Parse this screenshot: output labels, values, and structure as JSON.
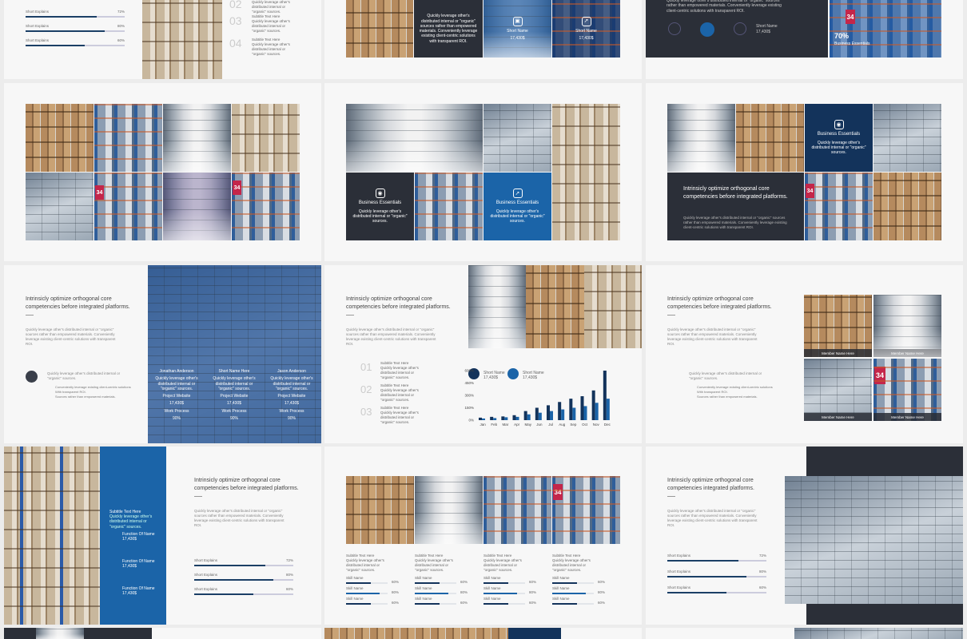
{
  "colors": {
    "navy": "#13335b",
    "blue": "#1b64a8",
    "dark": "#2b2f38",
    "page_bg": "#ececec"
  },
  "common": {
    "headline": "Intrinsicly optimize orthogonal core competencies before integrated platforms.",
    "headline_short": "Intrinsicly optimize orthogonal core competencies integrated platforms.",
    "body": "Quickly leverage other's distributed internal or \"organic\" sources rather than empowered materials. Conveniently leverage existing client-centric solutions with transparent ROI.",
    "body_small": "Quickly leverage other's distributed internal or \"organic\" sources.",
    "card_title": "Business Essentials",
    "card_body": "Quickly leverage other's distributed internal or \"organic\" sources.",
    "subtitle": "Subtitle Text Here",
    "short_name": "Short Name",
    "skill_name": "Skill Name",
    "member_name": "Member Name Here",
    "bullets": [
      "Conveniently leverage existing client-centric solutions",
      "With transparent ROI.",
      "Sources rather than empowered materials."
    ]
  },
  "slide1": {
    "bars": [
      {
        "label": "Short Explains",
        "pct": "72%",
        "value": 72
      },
      {
        "label": "Short Explains",
        "pct": "80%",
        "value": 80
      },
      {
        "label": "Short Explains",
        "pct": "60%",
        "value": 60
      }
    ]
  },
  "slide2": {
    "steps": [
      "02",
      "03",
      "04"
    ],
    "step_title": "Subtitle Text Here"
  },
  "slide3": {
    "stat_label": "Short Name",
    "stat_value": "17,430$"
  },
  "slide4": {
    "stat_label": "Short Name",
    "stat_value": "17,430$",
    "percent": "70%",
    "percent_text": "Business Essentials"
  },
  "slide7": {
    "columns": [
      {
        "title": "Jonathan Anderson",
        "stats": [
          {
            "label": "Project Website",
            "value": "17,430$"
          },
          {
            "label": "Work Process",
            "value": "90%"
          }
        ]
      },
      {
        "title": "Short Name Here",
        "stats": [
          {
            "label": "Project Website",
            "value": "17,430$"
          },
          {
            "label": "Work Process",
            "value": "90%"
          }
        ]
      },
      {
        "title": "Jason Anderson",
        "stats": [
          {
            "label": "Project Website",
            "value": "17,430$"
          },
          {
            "label": "Work Process",
            "value": "90%"
          }
        ]
      }
    ]
  },
  "slide8": {
    "steps": [
      "01",
      "02",
      "03"
    ],
    "legend": [
      {
        "label": "Short Name",
        "value": "17,430$"
      },
      {
        "label": "Short Name",
        "value": "17,430$"
      }
    ]
  },
  "chart_data": {
    "type": "bar",
    "categories": [
      "Jan",
      "Feb",
      "Mar",
      "Apr",
      "May",
      "Jun",
      "Jul",
      "Aug",
      "Sep",
      "Oct",
      "Nov",
      "Dec"
    ],
    "series": [
      {
        "name": "Short Name",
        "values": [
          30,
          40,
          45,
          60,
          110,
          150,
          180,
          220,
          260,
          290,
          360,
          600
        ]
      },
      {
        "name": "Short Name",
        "values": [
          20,
          25,
          35,
          40,
          70,
          90,
          110,
          130,
          150,
          170,
          210,
          260
        ]
      }
    ],
    "ytick_labels": [
      "0%",
      "150%",
      "300%",
      "450%",
      "600%"
    ],
    "ylim": [
      0,
      600
    ]
  },
  "slide10": {
    "stats": [
      {
        "label": "Function Of Name",
        "value": "17,430$"
      },
      {
        "label": "Function Of Name",
        "value": "17,430$"
      },
      {
        "label": "Function Of Name",
        "value": "17,430$"
      }
    ],
    "bars": [
      {
        "label": "Short Explains",
        "pct": "72%",
        "value": 72
      },
      {
        "label": "Short Explains",
        "pct": "80%",
        "value": 80
      },
      {
        "label": "Short Explains",
        "pct": "60%",
        "value": 60
      }
    ]
  },
  "slide11": {
    "skill_pcts": [
      "60%",
      "80%",
      "60%"
    ],
    "skill_values": [
      60,
      80,
      60
    ]
  },
  "slide12": {
    "bars": [
      {
        "label": "Short Explains",
        "pct": "72%",
        "value": 72
      },
      {
        "label": "Short Explains",
        "pct": "80%",
        "value": 80
      },
      {
        "label": "Short Explains",
        "pct": "60%",
        "value": 60
      }
    ]
  }
}
